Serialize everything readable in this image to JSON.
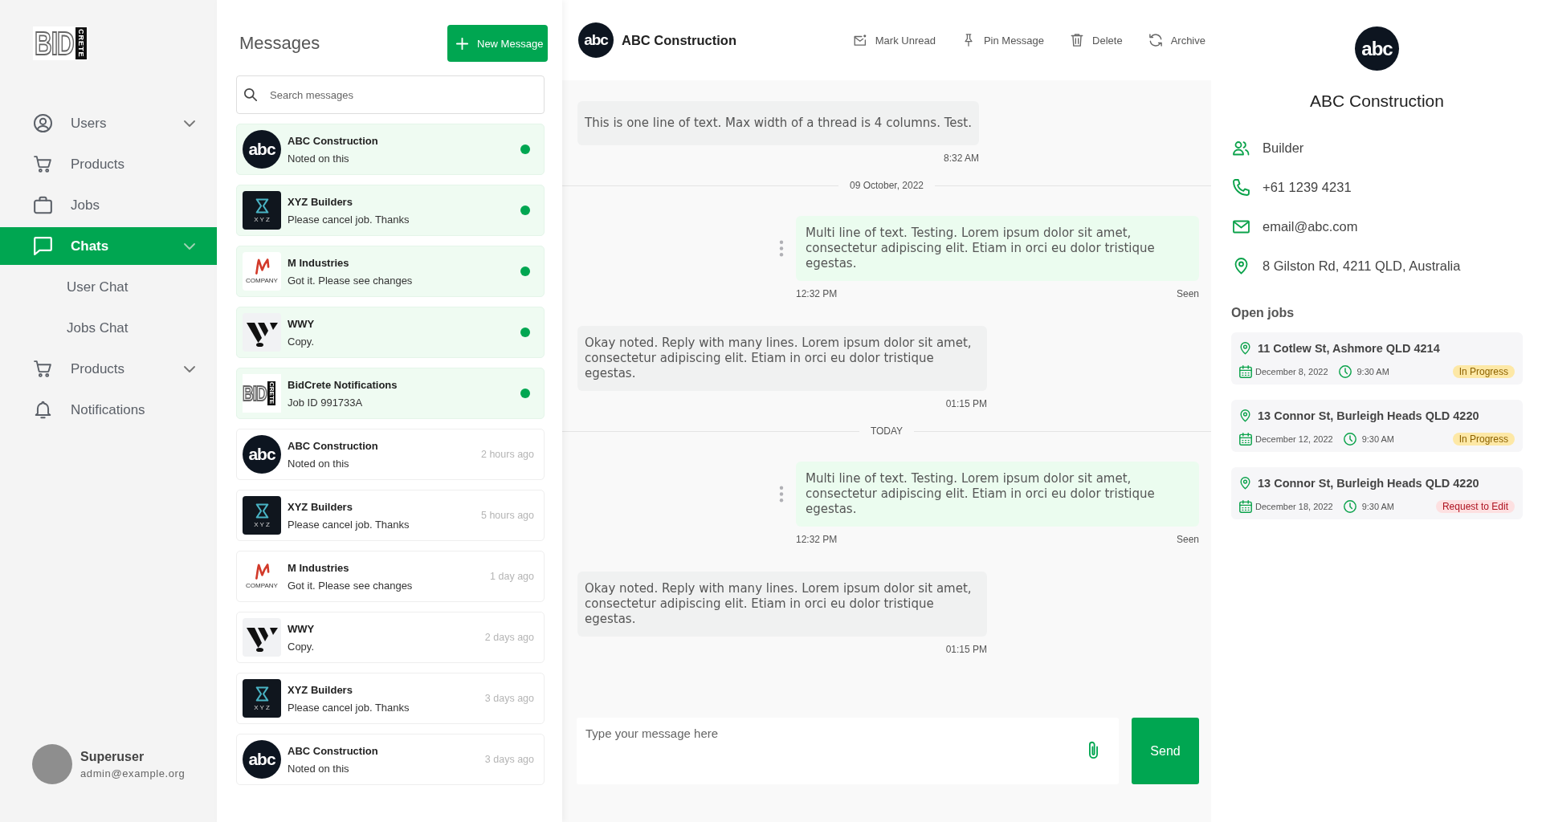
{
  "sidebar": {
    "logo": {
      "text": "BID",
      "subtext": "CRETE"
    },
    "items": [
      {
        "label": "Users",
        "expandable": true,
        "selected": false
      },
      {
        "label": "Products",
        "expandable": false,
        "selected": false
      },
      {
        "label": "Jobs",
        "expandable": false,
        "selected": false
      },
      {
        "label": "Chats",
        "expandable": true,
        "selected": true,
        "children": [
          {
            "label": "User Chat",
            "selected": false
          },
          {
            "label": "Jobs Chat",
            "selected": false
          }
        ]
      },
      {
        "label": "Products",
        "expandable": true,
        "selected": false
      },
      {
        "label": "Notifications",
        "expandable": false,
        "selected": false
      }
    ],
    "user": {
      "name": "Superuser",
      "email": "admin@example.org"
    }
  },
  "messages": {
    "title": "Messages",
    "new_button": "New Message",
    "search": {
      "placeholder": "Search messages"
    },
    "conversations": [
      {
        "name": "ABC Construction",
        "preview": "Noted on this",
        "unread": true,
        "avatar": {
          "kind": "monogram",
          "text": "abc"
        }
      },
      {
        "name": "XYZ Builders",
        "preview": "Please cancel job. Thanks",
        "unread": true,
        "avatar": {
          "kind": "hourglass",
          "text": "X Y Z"
        }
      },
      {
        "name": "M Industries",
        "preview": "Got it. Please see changes",
        "unread": true,
        "avatar": {
          "kind": "script",
          "text": "COMPANY"
        }
      },
      {
        "name": "WWY",
        "preview": "Copy.",
        "unread": true,
        "avatar": {
          "kind": "stripes"
        }
      },
      {
        "name": "BidCrete Notifications",
        "preview": "Job ID 991733A",
        "unread": true,
        "avatar": {
          "kind": "wordmark",
          "text": "BID",
          "subtext": "CRETE"
        }
      },
      {
        "name": "ABC Construction",
        "preview": "Noted on this",
        "unread": false,
        "time": "2 hours ago",
        "avatar": {
          "kind": "monogram",
          "text": "abc"
        }
      },
      {
        "name": "XYZ Builders",
        "preview": "Please cancel job. Thanks",
        "unread": false,
        "time": "5 hours ago",
        "avatar": {
          "kind": "hourglass",
          "text": "X Y Z"
        }
      },
      {
        "name": "M Industries",
        "preview": "Got it. Please see changes",
        "unread": false,
        "time": "1 day ago",
        "avatar": {
          "kind": "script",
          "text": "COMPANY"
        }
      },
      {
        "name": "WWY",
        "preview": "Copy.",
        "unread": false,
        "time": "2 days ago",
        "avatar": {
          "kind": "stripes"
        }
      },
      {
        "name": "XYZ Builders",
        "preview": "Please cancel job. Thanks",
        "unread": false,
        "time": "3 days ago",
        "avatar": {
          "kind": "hourglass",
          "text": "X Y Z"
        }
      },
      {
        "name": "ABC Construction",
        "preview": "Noted on this",
        "unread": false,
        "time": "3 days ago",
        "avatar": {
          "kind": "monogram",
          "text": "abc"
        }
      }
    ]
  },
  "chat": {
    "contact": {
      "name": "ABC Construction",
      "avatar": {
        "kind": "monogram",
        "text": "abc"
      }
    },
    "actions": [
      {
        "label": "Mark Unread"
      },
      {
        "label": "Pin Message"
      },
      {
        "label": "Delete"
      },
      {
        "label": "Archive"
      }
    ],
    "thread": [
      {
        "kind": "incoming",
        "text": "This is one line of text. Max width of a thread is 4 columns. Test.",
        "time": "8:32 AM"
      },
      {
        "kind": "divider",
        "label": "09 October, 2022"
      },
      {
        "kind": "outgoing",
        "text": "Multi line of text. Testing. Lorem ipsum dolor sit amet, consectetur adipiscing elit. Etiam in orci eu dolor tristique egestas.",
        "time": "12:32 PM",
        "status": "Seen"
      },
      {
        "kind": "incoming",
        "text": "Okay noted. Reply with many lines. Lorem ipsum dolor sit amet, consectetur adipiscing elit. Etiam in orci eu dolor tristique egestas.",
        "time": "01:15 PM"
      },
      {
        "kind": "divider",
        "label": "TODAY"
      },
      {
        "kind": "outgoing",
        "text": "Multi line of text. Testing. Lorem ipsum dolor sit amet, consectetur adipiscing elit. Etiam in orci eu dolor tristique egestas.",
        "time": "12:32 PM",
        "status": "Seen"
      },
      {
        "kind": "incoming",
        "text": "Okay noted. Reply with many lines. Lorem ipsum dolor sit amet, consectetur adipiscing elit. Etiam in orci eu dolor tristique egestas.",
        "time": "01:15 PM"
      }
    ],
    "composer": {
      "placeholder": "Type your message here",
      "send": "Send"
    }
  },
  "contact": {
    "avatar": {
      "kind": "monogram",
      "text": "abc"
    },
    "name": "ABC Construction",
    "details": [
      {
        "text": "Builder"
      },
      {
        "text": "+61 1239 4231"
      },
      {
        "text": "email@abc.com"
      },
      {
        "text": "8 Gilston Rd, 4211 QLD, Australia"
      }
    ],
    "open_jobs": {
      "title": "Open jobs",
      "jobs": [
        {
          "address": "11 Cotlew St, Ashmore QLD 4214",
          "date": "December 8, 2022",
          "time": "9:30 AM",
          "status": {
            "label": "In Progress",
            "kind": "progress"
          }
        },
        {
          "address": "13 Connor St, Burleigh Heads QLD 4220",
          "date": "December 12, 2022",
          "time": "9:30 AM",
          "status": {
            "label": "In Progress",
            "kind": "progress"
          }
        },
        {
          "address": "13 Connor St, Burleigh Heads QLD 4220",
          "date": "December 18, 2022",
          "time": "9:30 AM",
          "status": {
            "label": "Request to Edit",
            "kind": "request"
          }
        }
      ]
    }
  }
}
